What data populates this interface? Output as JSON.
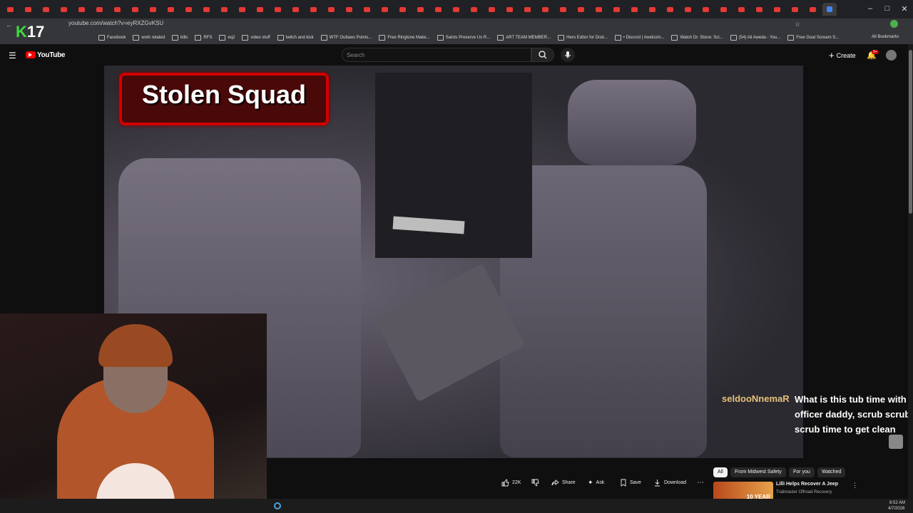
{
  "browser": {
    "url": "youtube.com/watch?v=eyRXZGvKSU",
    "bookmarks": [
      "Facebook",
      "work related",
      "bills",
      "RFS",
      "eq2",
      "video stuff",
      "twitch and kick",
      "WTF Outlaws Points...",
      "Free Ringtone Make...",
      "Saints Preserve Us R...",
      "ART TEAM MEMBER...",
      "Hero Editor for Disb...",
      "• Discord | #welcom...",
      "Watch Dr. Stone: Sci...",
      "(54) Ali Aweda - You...",
      "Free Goat Scream S..."
    ],
    "all_bookmarks": "All Bookmarks",
    "window_controls": [
      "–",
      "□",
      "✕"
    ]
  },
  "overlay": {
    "k_letter": "K",
    "k_number": "17",
    "title": "Stolen Squad"
  },
  "youtube": {
    "logo": "YouTube",
    "search_placeholder": "Search",
    "create": "Create",
    "notif_badge": "9+",
    "actions": {
      "likes": "22K",
      "share": "Share",
      "ask": "Ask",
      "save": "Save",
      "download": "Download"
    },
    "chips": [
      "All",
      "From Midwest Safety",
      "For you",
      "Watched"
    ],
    "recommendation": {
      "title": "Lilli Helps Recover A Jeep",
      "channel": "Trailmaster Offroad Recovery",
      "thumb_text": "10 YEAR"
    }
  },
  "chat": {
    "user": "seldooNnemaR",
    "message": "What is this tub time with officer daddy, scrub scrub scrub time to get clean"
  },
  "taskbar": {
    "time": "8:52 AM",
    "date": "4/7/2026"
  }
}
